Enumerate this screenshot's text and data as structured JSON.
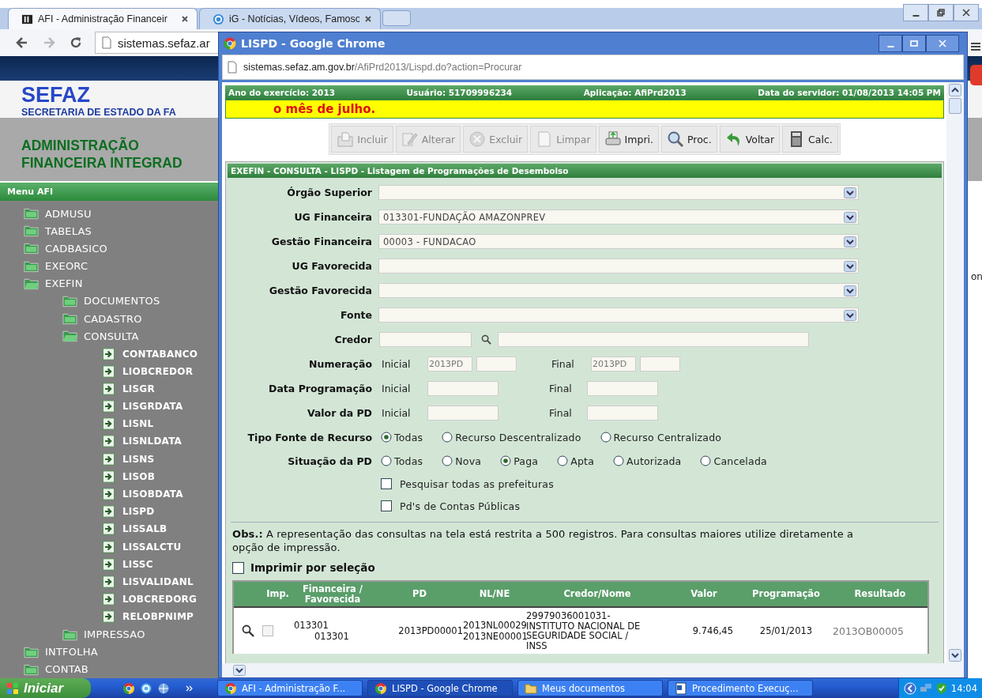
{
  "browser": {
    "tabs": [
      {
        "title": "AFI - Administração Financeir",
        "selected": true
      },
      {
        "title": "iG - Notícias, Vídeos, Famoso",
        "selected": false
      }
    ],
    "address": "sistemas.sefaz.ar"
  },
  "site": {
    "logo": "SEFAZ",
    "subtitle": "SECRETARIA DE ESTADO DA FA",
    "banner": [
      "ADMINISTRAÇÃO",
      "FINANCEIRA INTEGRAD"
    ],
    "menu_title": "Menu AFI",
    "menu": [
      {
        "label": "ADMUSU",
        "kind": "folder",
        "expanded": false
      },
      {
        "label": "TABELAS",
        "kind": "folder",
        "expanded": false
      },
      {
        "label": "CADBASICO",
        "kind": "folder",
        "expanded": false
      },
      {
        "label": "EXEORC",
        "kind": "folder",
        "expanded": false
      },
      {
        "label": "EXEFIN",
        "kind": "folder",
        "expanded": true,
        "children": [
          {
            "label": "DOCUMENTOS",
            "kind": "folder",
            "expanded": false
          },
          {
            "label": "CADASTRO",
            "kind": "folder",
            "expanded": false
          },
          {
            "label": "CONSULTA",
            "kind": "folder",
            "expanded": true,
            "children": [
              {
                "label": "CONTABANCO",
                "kind": "page"
              },
              {
                "label": "LIOBCREDOR",
                "kind": "page"
              },
              {
                "label": "LISGR",
                "kind": "page"
              },
              {
                "label": "LISGRDATA",
                "kind": "page"
              },
              {
                "label": "LISNL",
                "kind": "page"
              },
              {
                "label": "LISNLDATA",
                "kind": "page"
              },
              {
                "label": "LISNS",
                "kind": "page"
              },
              {
                "label": "LISOB",
                "kind": "page"
              },
              {
                "label": "LISOBDATA",
                "kind": "page"
              },
              {
                "label": "LISPD",
                "kind": "page"
              },
              {
                "label": "LISSALB",
                "kind": "page"
              },
              {
                "label": "LISSALCTU",
                "kind": "page"
              },
              {
                "label": "LISSC",
                "kind": "page"
              },
              {
                "label": "LISVALIDANL",
                "kind": "page"
              },
              {
                "label": "LOBCREDORG",
                "kind": "page"
              },
              {
                "label": "RELOBPNIMP",
                "kind": "page"
              }
            ]
          },
          {
            "label": "IMPRESSAO",
            "kind": "folder",
            "expanded": false
          }
        ]
      },
      {
        "label": "INTFOLHA",
        "kind": "folder",
        "expanded": false
      },
      {
        "label": "CONTAB",
        "kind": "folder",
        "expanded": false
      }
    ]
  },
  "edge_text": "on",
  "popup": {
    "title": "LISPD - Google Chrome",
    "url_host": "sistemas.sefaz.am.gov.br",
    "url_path": "/AfiPrd2013/Lispd.do?action=Procurar",
    "info": [
      "Ano do exercício: 2013",
      "Usuário: 51709996234",
      "Aplicação: AfiPrd2013",
      "Data do servidor: 01/08/2013 14:05 PM"
    ],
    "notice": "o mês de julho.",
    "toolbar": [
      {
        "label": "Incluir",
        "kind": "add",
        "disabled": true
      },
      {
        "label": "Alterar",
        "kind": "edit",
        "disabled": true
      },
      {
        "label": "Excluir",
        "kind": "delete",
        "disabled": true
      },
      {
        "label": "Limpar",
        "kind": "clear",
        "disabled": true
      },
      {
        "label": "Impri.",
        "kind": "print",
        "disabled": false
      },
      {
        "label": "Proc.",
        "kind": "search",
        "disabled": false
      },
      {
        "label": "Voltar",
        "kind": "back",
        "disabled": false
      },
      {
        "label": "Calc.",
        "kind": "calc",
        "disabled": false
      }
    ],
    "section_title": "EXEFIN - CONSULTA - LISPD - Listagem de Programações de Desembolso",
    "selects": [
      {
        "label": "Órgão Superior"
      },
      {
        "label": "UG Financeira",
        "value": "013301-FUNDAÇÃO AMAZONPREV"
      },
      {
        "label": "Gestão Financeira",
        "value": "00003 - FUNDACAO"
      },
      {
        "label": "UG Favorecida"
      },
      {
        "label": "Gestão Favorecida"
      },
      {
        "label": "Fonte"
      }
    ],
    "credor_label": "Credor",
    "ranges": [
      {
        "label": "Numeração",
        "kind": "number",
        "from_label": "Inicial",
        "from_value": "2013PD",
        "to_label": "Final",
        "to_value": "2013PD"
      },
      {
        "label": "Data Programação",
        "kind": "plain",
        "from_label": "Inicial",
        "to_label": "Final"
      },
      {
        "label": "Valor da PD",
        "kind": "plain",
        "from_label": "Inicial",
        "to_label": "Final"
      }
    ],
    "radio_groups": [
      {
        "label": "Tipo Fonte de Recurso",
        "options": [
          {
            "label": "Todas",
            "selected": true
          },
          {
            "label": "Recurso Descentralizado",
            "selected": false
          },
          {
            "label": "Recurso Centralizado",
            "selected": false
          }
        ]
      },
      {
        "label": "Situação da PD",
        "options": [
          {
            "label": "Todas",
            "selected": false
          },
          {
            "label": "Nova",
            "selected": false
          },
          {
            "label": "Paga",
            "selected": true
          },
          {
            "label": "Apta",
            "selected": false
          },
          {
            "label": "Autorizada",
            "selected": false
          },
          {
            "label": "Cancelada",
            "selected": false
          }
        ]
      }
    ],
    "checkboxes": [
      {
        "label": "Pesquisar todas as prefeituras",
        "checked": false
      },
      {
        "label": "Pd's de Contas Públicas",
        "checked": false
      }
    ],
    "obs": "**Obs.:** A representação das consultas na tela está restrita a 500 registros. Para consultas maiores utilize diretamente a opção de impressão.",
    "print_selection": {
      "label": "Imprimir por seleção",
      "checked": false
    },
    "table": {
      "columns": [
        "Imp.",
        "Financeira / Favorecida",
        "PD",
        "NL/NE",
        "Credor/Nome",
        "Valor",
        "Programação",
        "Resultado"
      ],
      "rows": [
        {
          "checked": false,
          "financeira": "013301",
          "favorecida": "013301",
          "pd": "2013PD00001",
          "nl": "2013NL00029",
          "ne": "2013NE00001",
          "credor": "29979036001031-INSTITUTO NACIONAL DE SEGURIDADE SOCIAL / INSS",
          "valor": "9.746,45",
          "programacao": "25/01/2013",
          "resultado": "2013OB00005"
        }
      ]
    }
  },
  "taskbar": {
    "start": "Iniciar",
    "tasks": [
      {
        "label": "AFI - Administração F...",
        "selected": false
      },
      {
        "label": "LISPD - Google Chrome",
        "selected": true
      },
      {
        "label": "Meus documentos",
        "selected": false
      },
      {
        "label": "Procedimento Execuç...",
        "selected": false
      }
    ],
    "clock": "14:04"
  }
}
